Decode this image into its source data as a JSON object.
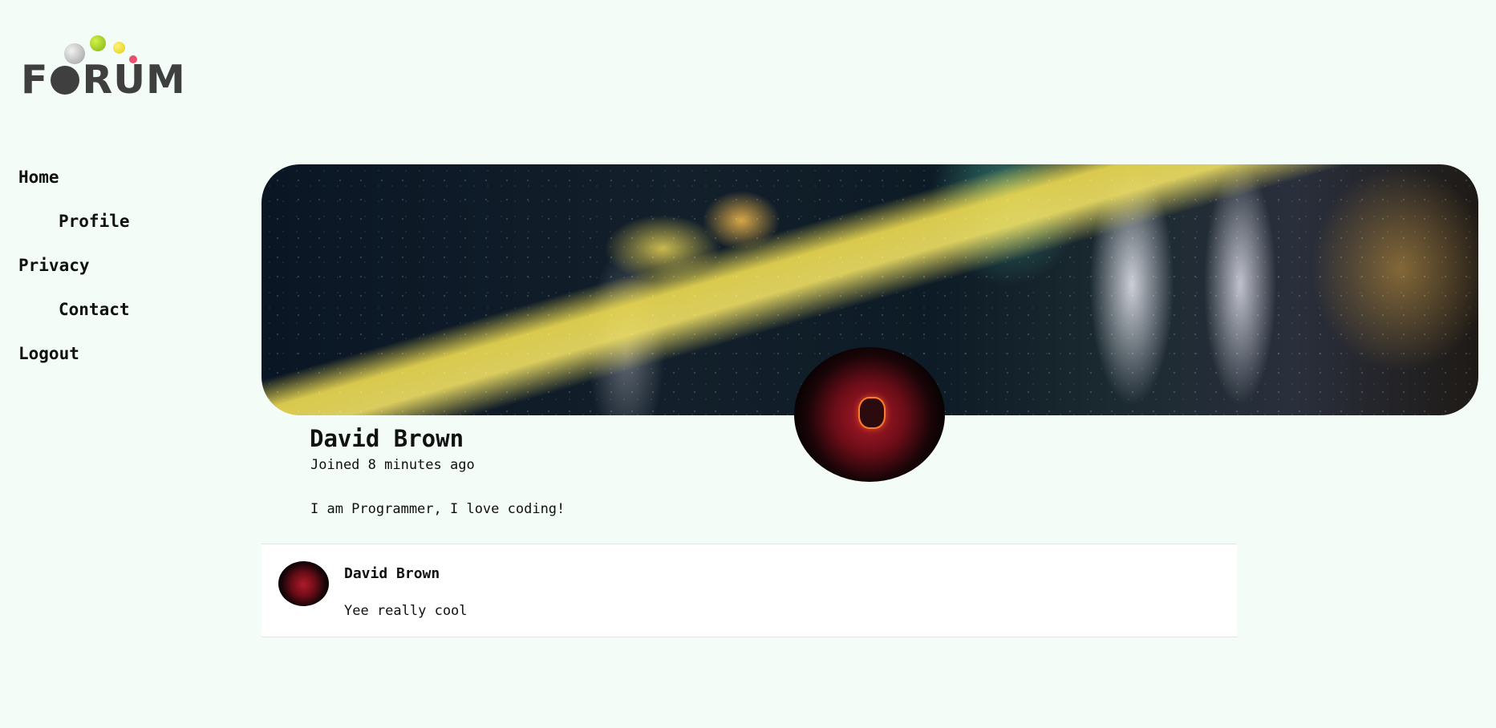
{
  "logo": {
    "text_prefix": "F",
    "text_suffix": "RUM"
  },
  "nav": {
    "items": [
      {
        "label": "Home"
      },
      {
        "label": "Profile"
      },
      {
        "label": "Privacy"
      },
      {
        "label": "Contact"
      },
      {
        "label": "Logout"
      }
    ]
  },
  "profile": {
    "name": "David Brown",
    "joined": "Joined 8 minutes ago",
    "bio": "I am Programmer, I love coding!"
  },
  "posts": [
    {
      "author": "David Brown",
      "text": "Yee really cool"
    }
  ]
}
